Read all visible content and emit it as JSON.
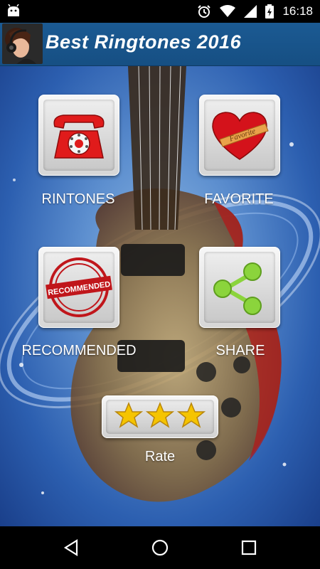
{
  "status_bar": {
    "time": "16:18",
    "icons": [
      "android-icon",
      "alarm-icon",
      "wifi-icon",
      "signal-icon",
      "battery-icon"
    ]
  },
  "app_bar": {
    "title": "Best Ringtones 2016",
    "logo": "headphones-woman-logo"
  },
  "menu": {
    "ringtones_label": "RINTONES",
    "favorite_label": "FAVORITE",
    "favorite_ribbon_text": "Favorite",
    "recommended_label": "RECOMMENDED",
    "recommended_stamp_text": "RECOMMENDED",
    "share_label": "SHARE",
    "rate_label": "Rate"
  },
  "nav_bar": {
    "icons": [
      "back-icon",
      "home-icon",
      "recents-icon"
    ]
  },
  "colors": {
    "app_bar": "#1b5a93",
    "background": "#5d8fcf",
    "phone_red": "#e01b1b",
    "heart_red": "#d4121b",
    "share_green": "#8bd43c",
    "star_yellow": "#f5c400"
  }
}
